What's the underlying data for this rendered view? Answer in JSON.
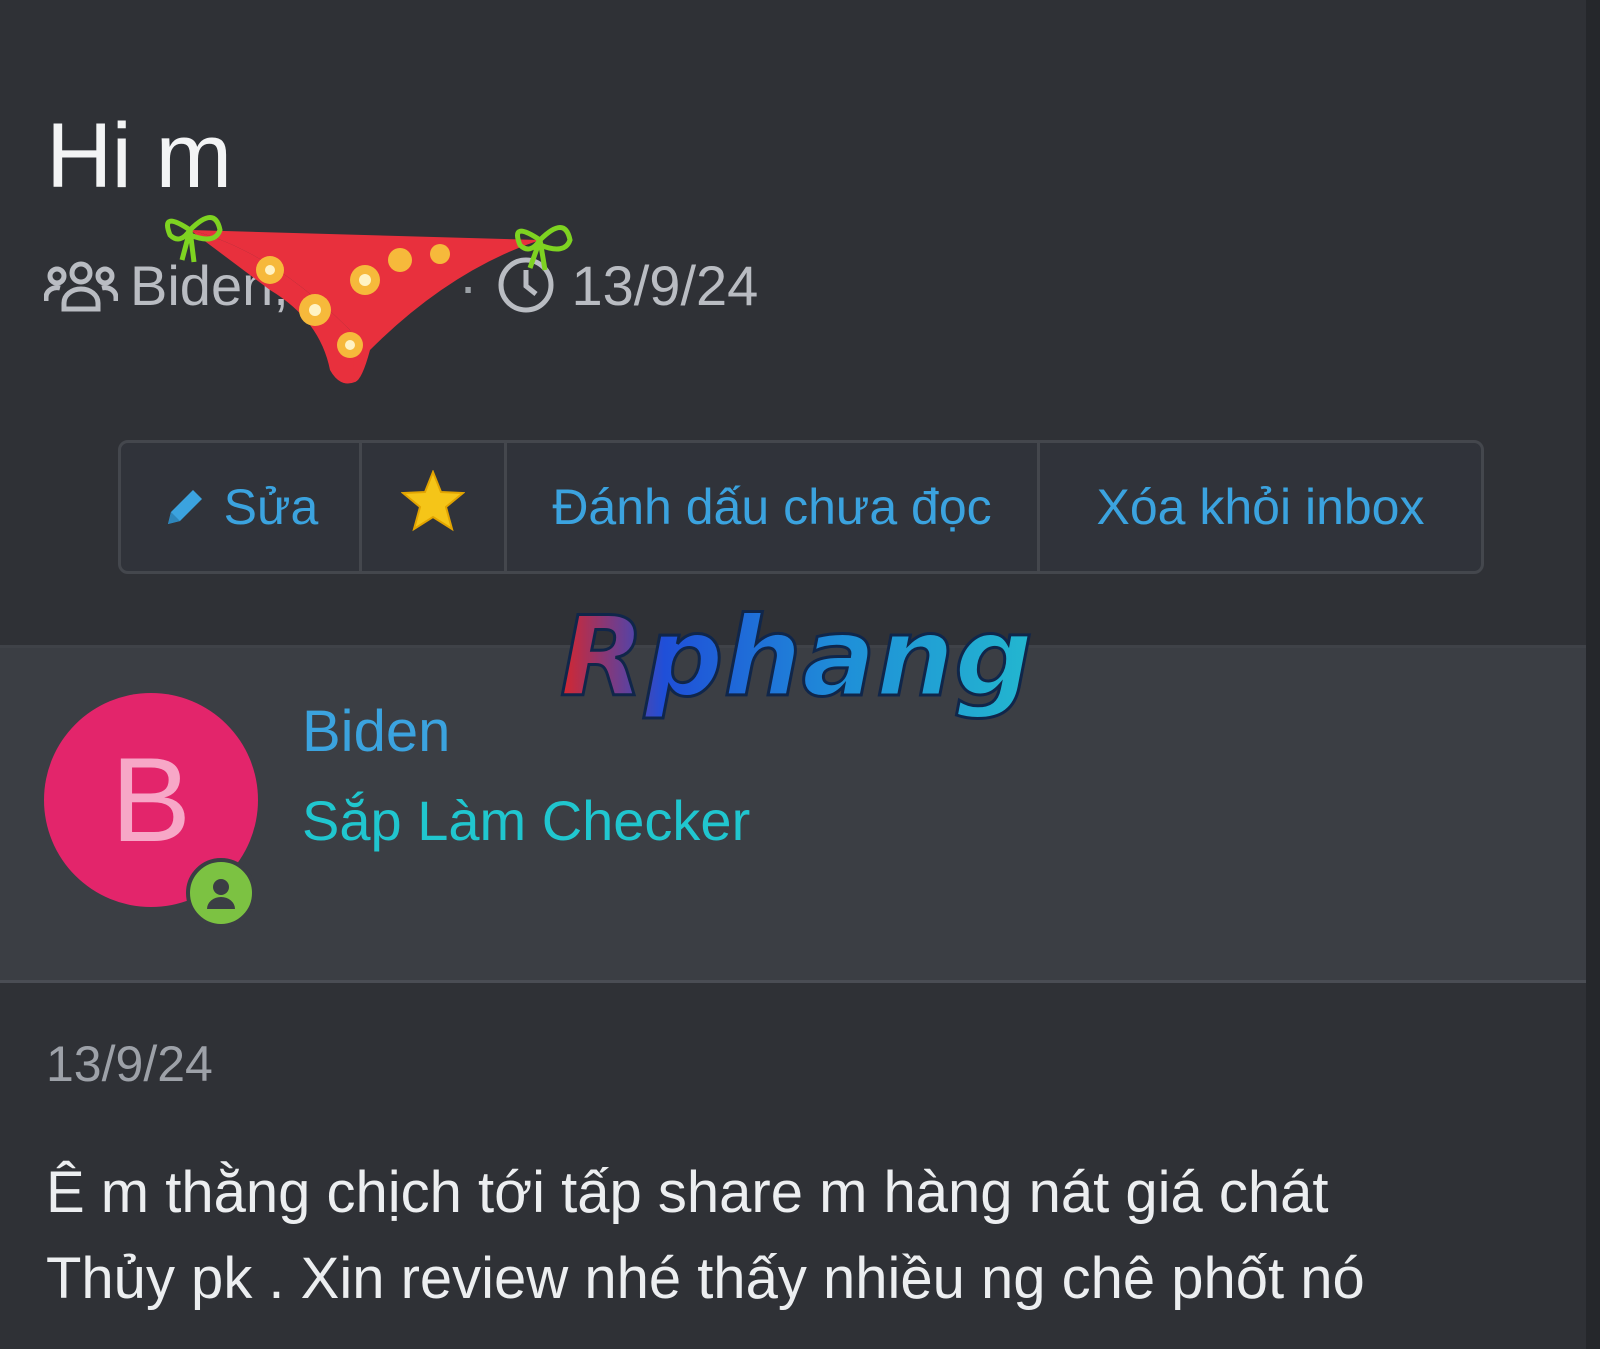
{
  "conversation": {
    "title": "Hi m",
    "participants": "Biden,",
    "separator": "·",
    "date": "13/9/24"
  },
  "actions": {
    "edit_label": "Sửa",
    "mark_unread_label": "Đánh dấu chưa đọc",
    "remove_inbox_label": "Xóa khỏi inbox"
  },
  "watermark": {
    "text": "Rphang"
  },
  "message": {
    "avatar_letter": "B",
    "author": "Biden",
    "user_title": "Sắp Làm Checker",
    "date": "13/9/24",
    "lines": [
      "Ê m thằng chịch tới tấp share m hàng nát giá chát",
      "Thủy pk . Xin review nhé thấy nhiều ng chê phốt nó"
    ]
  },
  "colors": {
    "background": "#2f3136",
    "panel": "#3b3e44",
    "link": "#3ba3df",
    "user_title": "#20c6cf",
    "avatar": "#e3256b",
    "online": "#7cc242",
    "star": "#f5c518"
  },
  "icons": {
    "participants": "users-icon",
    "time": "clock-icon",
    "edit": "pencil-icon",
    "star": "star-icon",
    "online": "user-online-icon"
  }
}
